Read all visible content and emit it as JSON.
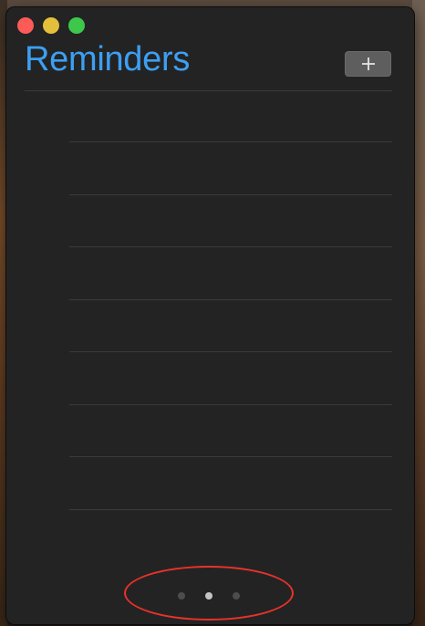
{
  "window": {
    "title": "Reminders",
    "add_button_icon": "plus-icon",
    "traffic_lights": [
      "close",
      "minimize",
      "zoom"
    ]
  },
  "list": {
    "row_count": 8,
    "rows": [
      "",
      "",
      "",
      "",
      "",
      "",
      "",
      ""
    ]
  },
  "pager": {
    "page_count": 3,
    "active_page": 2
  },
  "colors": {
    "title": "#3d9ff2",
    "window_bg": "#232323",
    "annotation": "#e8322a"
  }
}
